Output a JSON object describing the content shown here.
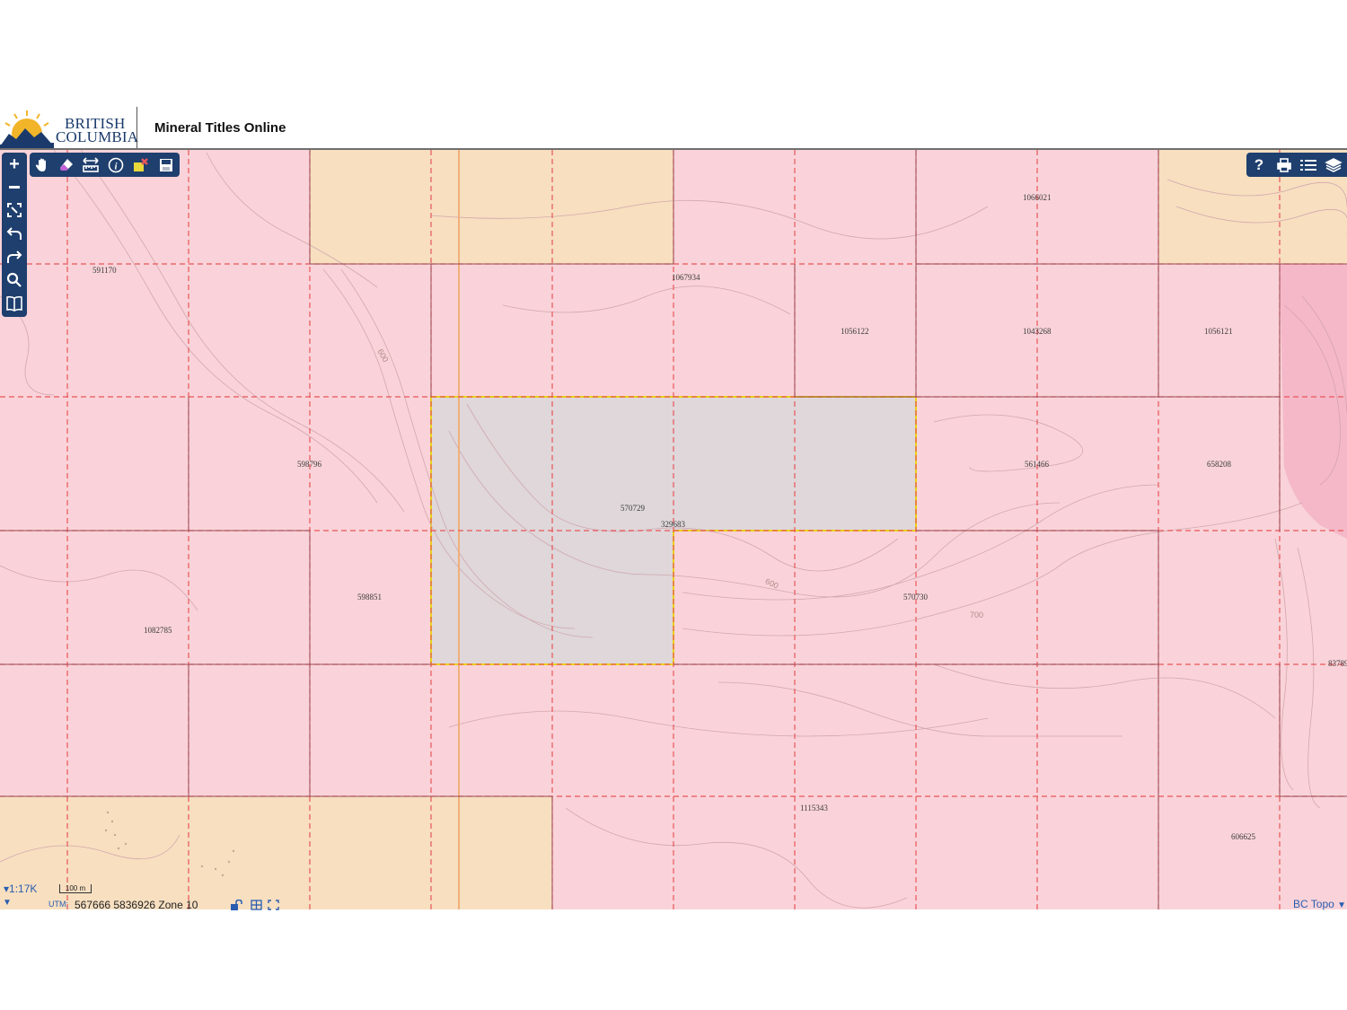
{
  "header": {
    "logo_line1": "BRITISH",
    "logo_line2": "COLUMBIA",
    "app_title": "Mineral Titles Online"
  },
  "colors": {
    "claim_fill": "#f9d3d9",
    "tenure_fill": "#f7dfc0",
    "selected_fill": "#dfd7da",
    "selected_outline": "#e8d21c",
    "grid_dashed": "#e8565a",
    "claim_border": "#9a4a55",
    "toolbar_bg": "#1f3f6e"
  },
  "map": {
    "claim_labels": [
      {
        "id": "591170"
      },
      {
        "id": "1067934"
      },
      {
        "id": "1066021"
      },
      {
        "id": "1056122"
      },
      {
        "id": "1043268"
      },
      {
        "id": "1056121"
      },
      {
        "id": "598796"
      },
      {
        "id": "570729"
      },
      {
        "id": "329683"
      },
      {
        "id": "561466"
      },
      {
        "id": "658208"
      },
      {
        "id": "598851"
      },
      {
        "id": "570730"
      },
      {
        "id": "1082785"
      },
      {
        "id": "1115343"
      },
      {
        "id": "606625"
      },
      {
        "id": "83789"
      }
    ],
    "contour_labels": [
      "600",
      "600",
      "700"
    ]
  },
  "toolbar": {
    "left_tools": [
      "zoom-in",
      "zoom-out",
      "zoom-extent",
      "undo",
      "redo",
      "search",
      "bookmark"
    ],
    "top_tools": [
      "pan",
      "eraser",
      "measure",
      "info",
      "clear-selection",
      "save"
    ],
    "right_tools": [
      "help",
      "print",
      "legend",
      "layers"
    ]
  },
  "footer": {
    "scale": "1:17K",
    "scalebar_label": "100 m",
    "coord_system": "UTM:",
    "coordinates": "567666 5836926 Zone 10",
    "basemap": "BC Topo"
  }
}
